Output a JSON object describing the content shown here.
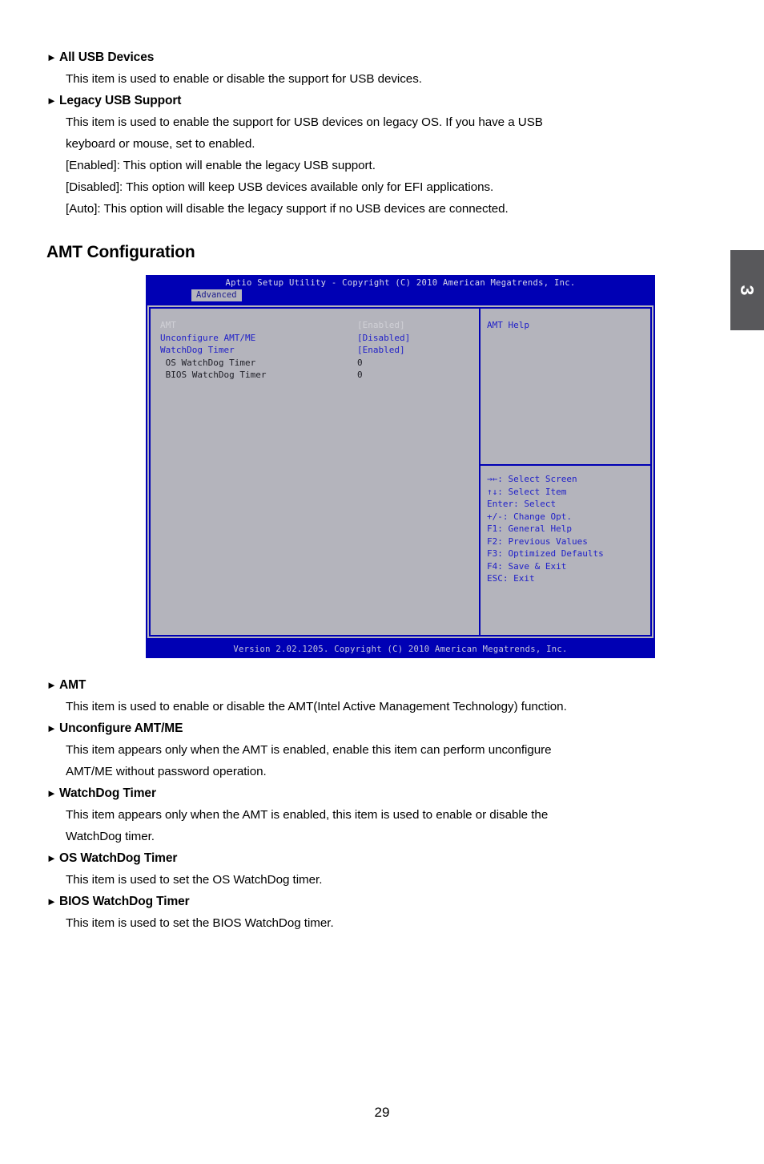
{
  "page": {
    "number": "29",
    "tab_number": "3"
  },
  "top_section": {
    "items": [
      {
        "title": "All USB Devices",
        "lines": [
          "This item is used to enable or disable the support for USB devices."
        ]
      },
      {
        "title": "Legacy USB Support",
        "lines": [
          "This item is used to enable the support for USB devices on legacy OS. If you have a USB",
          "keyboard or mouse, set to enabled.",
          "[Enabled]: This option will enable the legacy USB support.",
          "[Disabled]: This option will keep USB devices available only for EFI applications.",
          "[Auto]: This option will disable the legacy support if no USB devices are connected."
        ]
      }
    ]
  },
  "heading": "AMT Configuration",
  "bios": {
    "title_bar": "Aptio Setup Utility - Copyright (C) 2010 American Megatrends, Inc.",
    "active_tab": "Advanced",
    "options": [
      {
        "label": "AMT",
        "value": "[Enabled]",
        "style": "dim"
      },
      {
        "label": "Unconfigure AMT/ME",
        "value": "[Disabled]",
        "style": "blue"
      },
      {
        "label": "WatchDog Timer",
        "value": "[Enabled]",
        "style": "blue"
      },
      {
        "label": " OS WatchDog Timer",
        "value": "0",
        "style": "dark"
      },
      {
        "label": " BIOS WatchDog Timer",
        "value": "0",
        "style": "dark"
      }
    ],
    "help_title": "AMT Help",
    "help_body": "",
    "keys": [
      "→←: Select Screen",
      "↑↓: Select Item",
      "Enter: Select",
      "+/-: Change Opt.",
      "F1: General Help",
      "F2: Previous Values",
      "F3: Optimized Defaults",
      "F4: Save & Exit",
      "ESC: Exit"
    ],
    "footer": "Version 2.02.1205. Copyright (C) 2010 American Megatrends, Inc."
  },
  "bottom_section": {
    "items": [
      {
        "title": "AMT",
        "lines": [
          "This item is used to enable or disable the AMT(Intel Active Management Technology) function."
        ]
      },
      {
        "title": "Unconfigure AMT/ME",
        "lines": [
          "This item appears only when the AMT is enabled, enable this item can perform unconfigure",
          "AMT/ME without password operation."
        ]
      },
      {
        "title": "WatchDog Timer",
        "lines": [
          "This item appears only when the AMT is enabled, this item is used to enable or disable the",
          "WatchDog timer."
        ]
      },
      {
        "title": "OS WatchDog Timer",
        "lines": [
          "This item is used to set the OS WatchDog timer."
        ]
      },
      {
        "title": "BIOS WatchDog Timer",
        "lines": [
          "This item is used to set the BIOS WatchDog timer."
        ]
      }
    ]
  },
  "colors": {
    "bios_blue": "#0000b4",
    "bios_gray": "#b4b4bc",
    "bios_text_blue": "#2020c8",
    "tab_gray": "#58585b"
  }
}
